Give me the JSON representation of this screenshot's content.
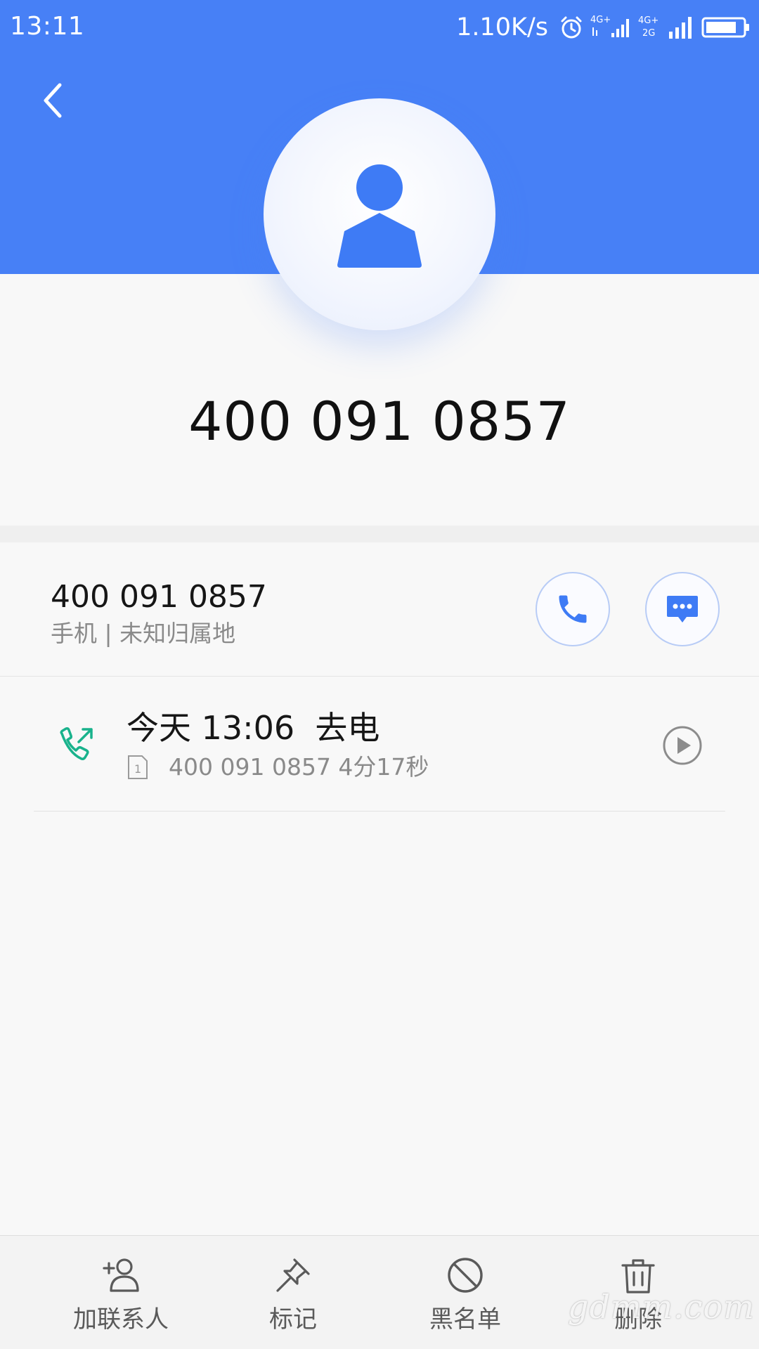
{
  "status_bar": {
    "time": "13:11",
    "net_speed": "1.10K/s",
    "icons": [
      "alarm-icon",
      "4g-signal-icon",
      "4g-2g-signal-icon",
      "signal-bars-icon",
      "battery-icon"
    ]
  },
  "header": {
    "back_icon": "chevron-left-icon",
    "avatar_icon": "person-icon",
    "number": "400 091 0857"
  },
  "contact": {
    "number": "400 091 0857",
    "subtitle": "手机 | 未知归属地",
    "call_icon": "phone-icon",
    "message_icon": "message-icon"
  },
  "call_log": [
    {
      "title": "今天 13:06  去电",
      "sim_label": "1",
      "detail": "400 091 0857 4分17秒",
      "direction_icon": "outgoing-call-icon",
      "play_icon": "play-icon"
    }
  ],
  "bottom_bar": {
    "add_contact": "加联系人",
    "mark": "标记",
    "blacklist": "黑名单",
    "delete": "删除"
  },
  "watermark": "gdmm.com",
  "colors": {
    "header_blue": "#4780f6",
    "accent_blue": "#3e7bf5",
    "call_green": "#19b28c",
    "text_gray": "#8a8a8a"
  }
}
